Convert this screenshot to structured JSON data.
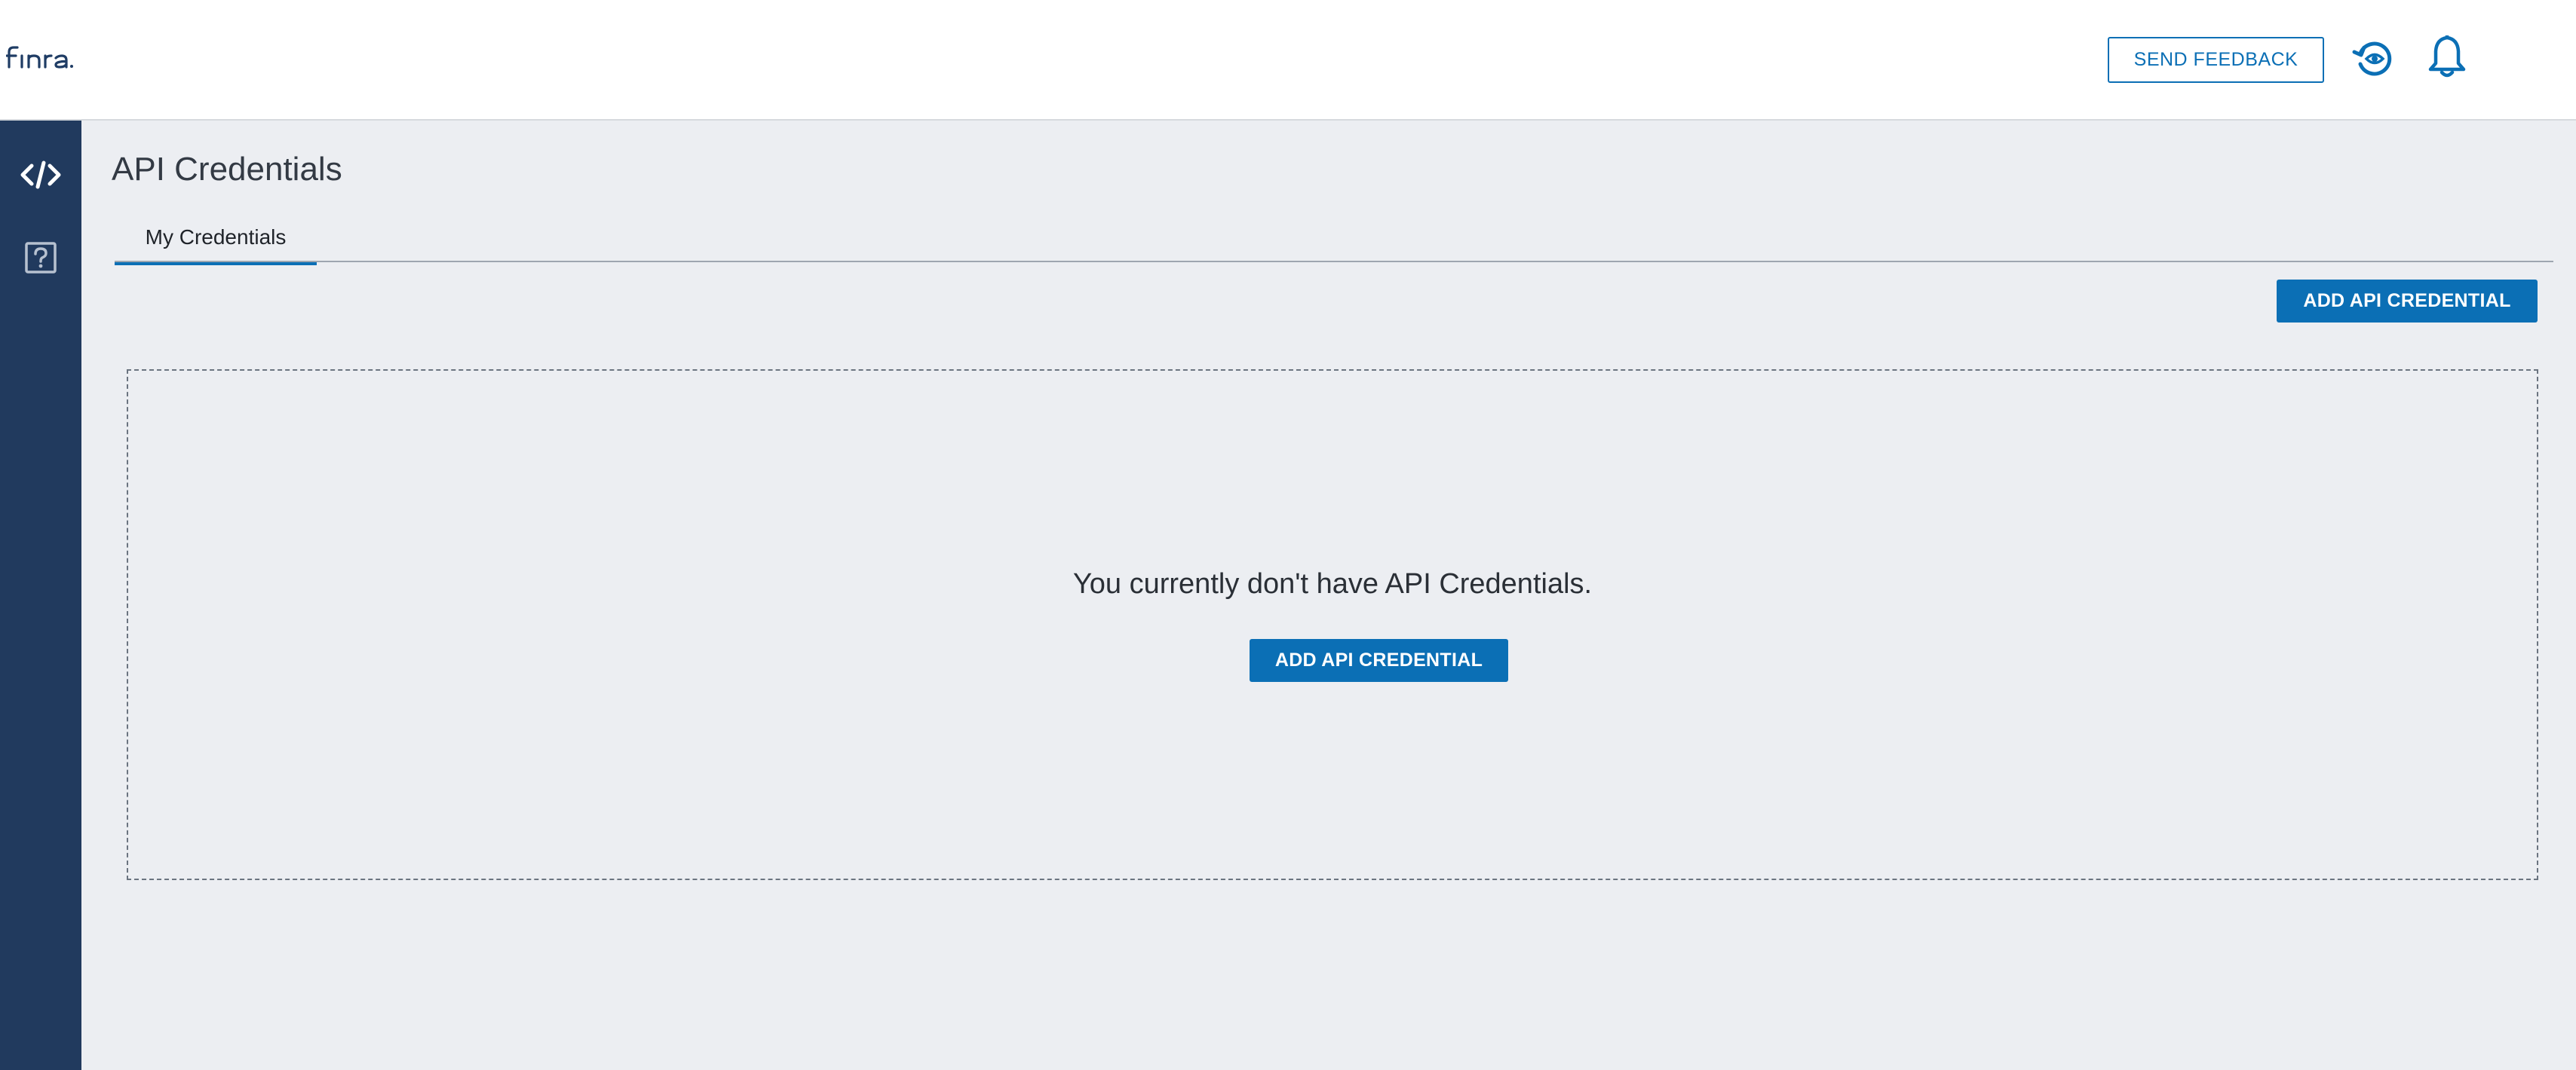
{
  "header": {
    "logo_text": "FINRA",
    "send_feedback_label": "SEND FEEDBACK",
    "icons": [
      "history-eye-icon",
      "bell-icon"
    ]
  },
  "sidebar": {
    "items": [
      {
        "icon": "code-icon",
        "active": true
      },
      {
        "icon": "help-icon",
        "active": false
      }
    ]
  },
  "main": {
    "title": "API Credentials",
    "tabs": [
      {
        "label": "My Credentials",
        "active": true
      }
    ],
    "add_button_label": "ADD API CREDENTIAL",
    "empty_state": {
      "message": "You currently don't have API Credentials.",
      "button_label": "ADD API CREDENTIAL"
    }
  },
  "colors": {
    "accent": "#0b6fb5",
    "sidebar": "#213a5e",
    "background": "#eceef2",
    "logo": "#1f3c64"
  }
}
